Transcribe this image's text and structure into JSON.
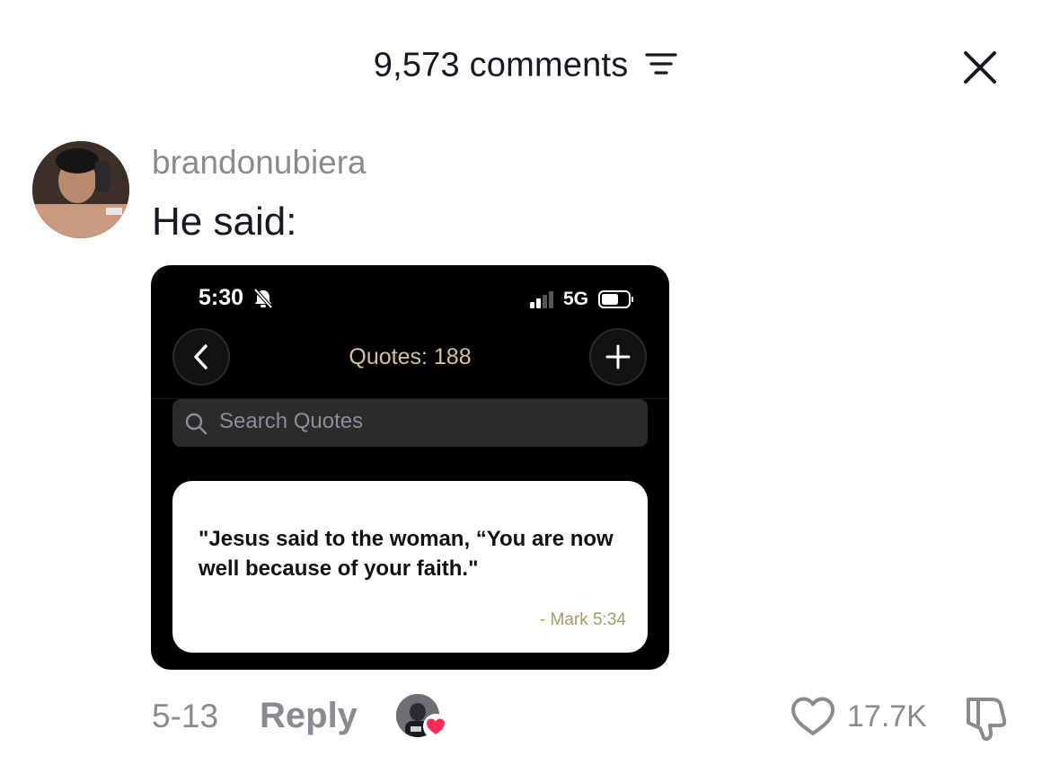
{
  "header": {
    "title": "9,573 comments",
    "filter_icon": "filter-lines-icon",
    "close_icon": "close-icon"
  },
  "comment": {
    "username": "brandonubiera",
    "text": "He said:",
    "date": "5-13",
    "reply_label": "Reply",
    "like_count": "17.7K",
    "liked_by_creator": true
  },
  "attached_image": {
    "status_time": "5:30",
    "network": "5G",
    "title": "Quotes: 188",
    "search_placeholder": "Search Quotes",
    "quote_text": "\"Jesus said to the woman, “You are now well because of your faith.\"",
    "quote_source": "- Mark 5:34"
  },
  "colors": {
    "meta_gray": "#8a8b91",
    "text_dark": "#161823",
    "heart_red": "#fe2c55",
    "quotes_title_gold": "#d8c096",
    "quote_source_gold": "#a89a63"
  }
}
